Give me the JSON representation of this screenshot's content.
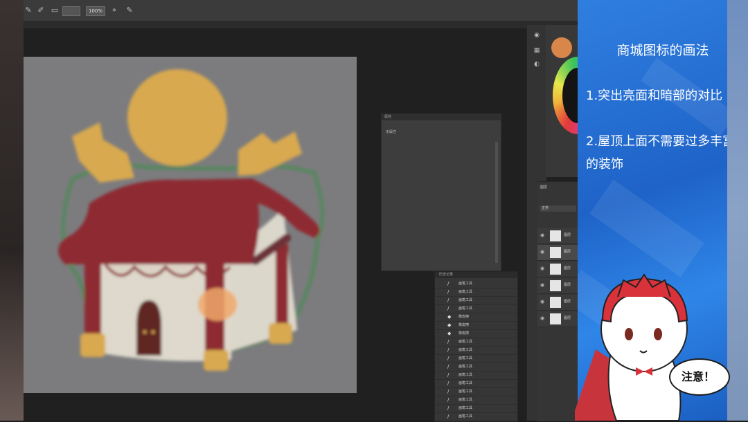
{
  "options_bar": {
    "zoom_value": "100%"
  },
  "properties_panel": {
    "title": "属性",
    "body_text": "无属性"
  },
  "history_panel": {
    "title": "历史记录",
    "rows": [
      "画笔工具",
      "画笔工具",
      "画笔工具",
      "画笔工具",
      "橡皮擦",
      "橡皮擦",
      "橡皮擦",
      "画笔工具",
      "画笔工具",
      "画笔工具",
      "画笔工具",
      "画笔工具",
      "画笔工具",
      "画笔工具",
      "画笔工具",
      "画笔工具",
      "画笔工具"
    ]
  },
  "layers_panel": {
    "tab": "图层",
    "blend_mode": "正常",
    "layers": [
      "图层",
      "图层",
      "图层",
      "图层",
      "图层",
      "图层"
    ]
  },
  "colors": {
    "foreground": "#d9864a",
    "tutorial_blue": "#2f7fe0",
    "roof_red": "#8e2a33",
    "gold": "#d8a94f"
  },
  "tutorial": {
    "title": "商城图标的画法",
    "point1": "1.突出亮面和暗部的对比",
    "point2": "2.屋顶上面不需要过多丰富的装饰",
    "speech": "注意！"
  }
}
